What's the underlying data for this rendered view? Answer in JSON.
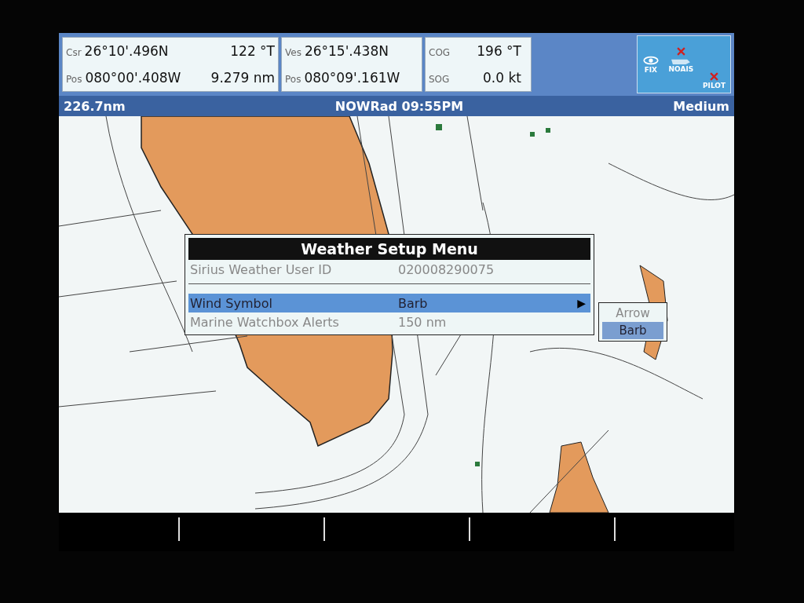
{
  "data_panels": [
    {
      "rows": [
        {
          "label": "Csr",
          "value": "26°10'.496N",
          "extra": "122 °T"
        },
        {
          "label": "Pos",
          "value": "080°00'.408W",
          "extra": "9.279 nm"
        }
      ]
    },
    {
      "rows": [
        {
          "label": "Ves",
          "value": "26°15'.438N"
        },
        {
          "label": "Pos",
          "value": "080°09'.161W"
        }
      ]
    },
    {
      "rows": [
        {
          "label": "COG",
          "value": "196 °T"
        },
        {
          "label": "SOG",
          "value": "0.0 kt"
        }
      ]
    }
  ],
  "status_icons": [
    {
      "label": "FIX",
      "crossed": false
    },
    {
      "label": "NOAIS",
      "crossed": true
    },
    {
      "label": "PILOT",
      "crossed": true
    }
  ],
  "header": {
    "range": "226.7nm",
    "title": "NOWRad 09:55PM",
    "mode": "Medium"
  },
  "menu": {
    "title": "Weather Setup Menu",
    "rows": [
      {
        "label": "Sirius Weather User ID",
        "value": "020008290075",
        "selected": false,
        "divider_after": true
      },
      {
        "label": "Wind Symbol",
        "value": "Barb",
        "selected": true,
        "submenu_marker": "▶"
      },
      {
        "label": "Marine Watchbox Alerts",
        "value": "150 nm",
        "selected": false
      }
    ],
    "submenu": [
      {
        "label": "Arrow",
        "selected": false
      },
      {
        "label": "Barb",
        "selected": true
      }
    ]
  }
}
